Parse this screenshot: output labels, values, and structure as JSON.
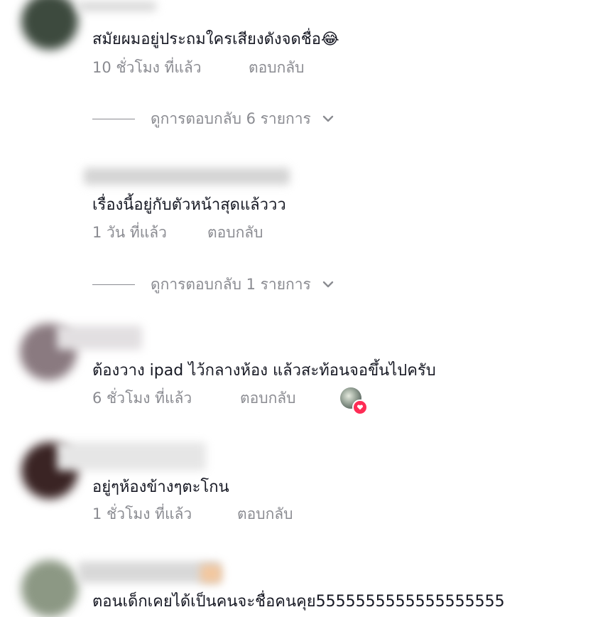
{
  "comments": [
    {
      "text": "สมัยผมอยู่ประถมใครเสียงดังจดชื่อ😂",
      "time": "10 ชั่วโมง ที่แล้ว",
      "reply": "ตอบกลับ",
      "view_replies": "ดูการตอบกลับ 6 รายการ"
    },
    {
      "text": "เรื่องนี้อยู่กับตัวหน้าสุดแล้ววว",
      "time": "1 วัน ที่แล้ว",
      "reply": "ตอบกลับ",
      "view_replies": "ดูการตอบกลับ 1 รายการ"
    },
    {
      "text": "ต้องวาง ipad ไว้กลางห้อง แล้วสะท้อนจอขึ้นไปครับ",
      "time": "6 ชั่วโมง ที่แล้ว",
      "reply": "ตอบกลับ"
    },
    {
      "text": "อยู่ๆห้องข้างๆตะโกน",
      "time": "1 ชั่วโมง ที่แล้ว",
      "reply": "ตอบกลับ"
    },
    {
      "text": "ตอนเด็กเคยได้เป็นคนจะชื่อคนคุย5555555555555555555"
    }
  ],
  "colors": {
    "text": "#161823",
    "meta": "#8a8b91",
    "heart": "#fe2c55"
  },
  "icons": {
    "chevron": "chevron-down-icon",
    "heart": "heart-icon"
  }
}
